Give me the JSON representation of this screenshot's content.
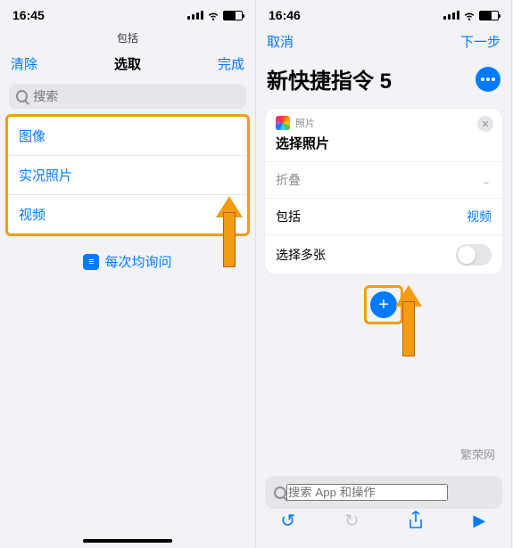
{
  "left": {
    "time": "16:45",
    "include_header": "包括",
    "nav": {
      "clear": "清除",
      "title": "选取",
      "done": "完成"
    },
    "search_placeholder": "搜索",
    "items": [
      "图像",
      "实况照片",
      "视频"
    ],
    "ask_label": "每次均询问"
  },
  "right": {
    "time": "16:46",
    "nav": {
      "cancel": "取消",
      "next": "下一步"
    },
    "title": "新快捷指令 5",
    "card": {
      "app_label": "照片",
      "action_title": "选择照片",
      "fold": "折叠",
      "include_label": "包括",
      "include_value": "视频",
      "multi_label": "选择多张"
    },
    "bottom_search_placeholder": "搜索 App 和操作",
    "watermark": "繁荣网"
  }
}
